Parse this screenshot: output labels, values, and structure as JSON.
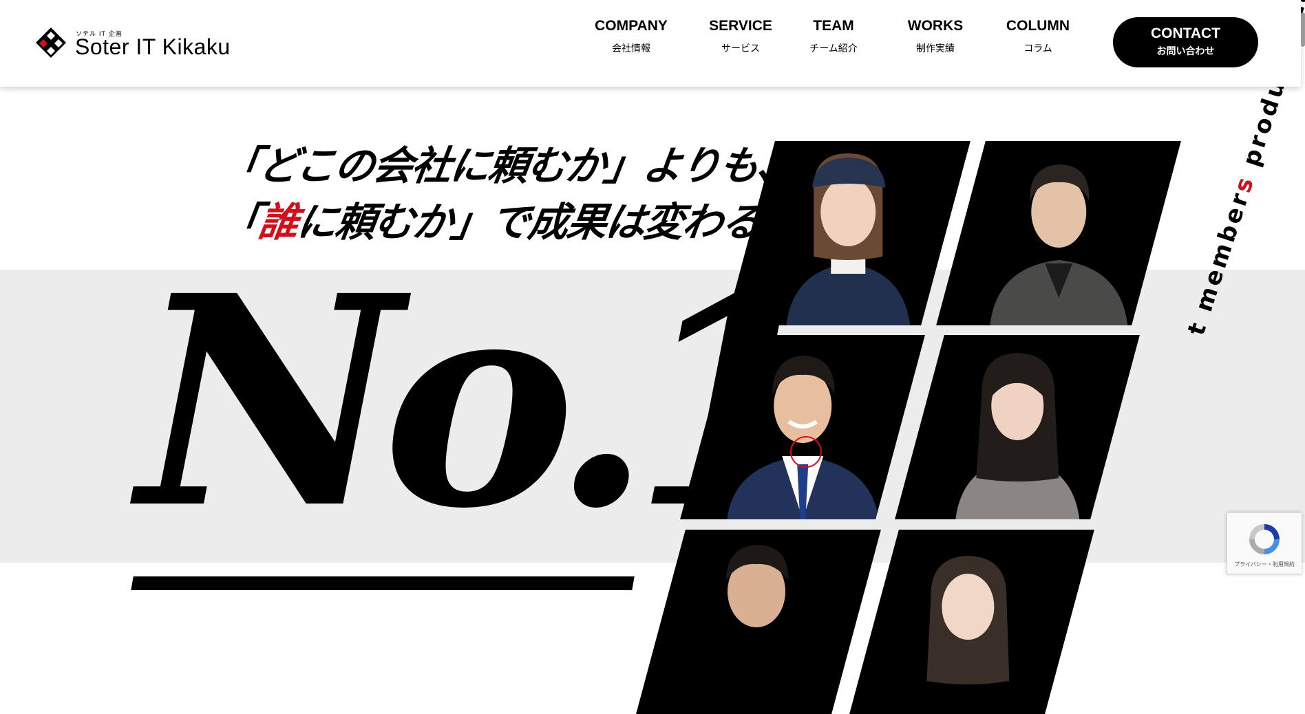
{
  "header": {
    "logo": {
      "sub": "ソテル IT 企画",
      "name": "Soter IT Kikaku"
    },
    "nav": [
      {
        "en": "COMPANY",
        "ja": "会社情報"
      },
      {
        "en": "SERVICE",
        "ja": "サービス"
      },
      {
        "en": "TEAM",
        "ja": "チーム紹介"
      },
      {
        "en": "WORKS",
        "ja": "制作実績"
      },
      {
        "en": "COLUMN",
        "ja": "コラム"
      }
    ],
    "contact": {
      "en": "CONTACT",
      "ja": "お問い合わせ"
    }
  },
  "hero": {
    "headline": {
      "line1": "「どこの会社に頼むか」よりも、",
      "line2_open": "「",
      "line2_red": "誰",
      "line2_rest": "に頼むか」で成果は変わる。"
    },
    "big_text": "No.1",
    "tagline": {
      "pre": "t member",
      "accent": "s",
      "post": " produce results"
    }
  },
  "recaptcha": {
    "text": "プライバシー・利用規約"
  },
  "colors": {
    "accent": "#d0111b",
    "black": "#000000",
    "band": "#ececec"
  }
}
